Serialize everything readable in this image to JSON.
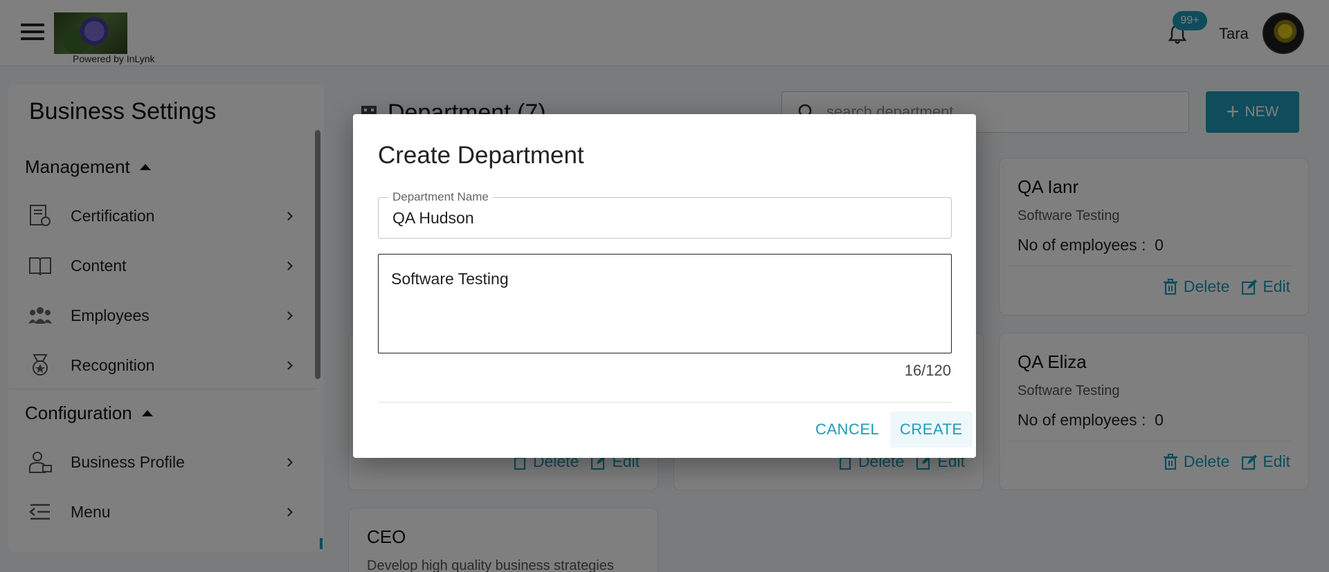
{
  "header": {
    "powered_by": "Powered by InLynk",
    "notification_badge": "99+",
    "user_name": "Tara"
  },
  "sidebar": {
    "title": "Business Settings",
    "sections": [
      {
        "label": "Management",
        "items": [
          {
            "label": "Certification",
            "icon": "certificate-icon"
          },
          {
            "label": "Content",
            "icon": "book-icon"
          },
          {
            "label": "Employees",
            "icon": "people-icon"
          },
          {
            "label": "Recognition",
            "icon": "medal-icon"
          }
        ]
      },
      {
        "label": "Configuration",
        "items": [
          {
            "label": "Business Profile",
            "icon": "business-person-icon"
          },
          {
            "label": "Menu",
            "icon": "menu-list-icon"
          }
        ]
      }
    ]
  },
  "main": {
    "title": "Department (7)",
    "search_placeholder": "search department...",
    "new_button": "NEW",
    "cards": [
      {
        "name": "QA Ianr",
        "description": "Software Testing",
        "employees_label": "No of employees :",
        "employees": "0",
        "delete": "Delete",
        "edit": "Edit"
      },
      {
        "name": "QA Eliza",
        "description": "Software Testing",
        "employees_label": "No of employees :",
        "employees": "0",
        "delete": "Delete",
        "edit": "Edit"
      },
      {
        "name": "",
        "description": "",
        "employees_label": "",
        "employees": "",
        "delete": "Delete",
        "edit": "Edit"
      },
      {
        "name": "",
        "description": "",
        "employees_label": "",
        "employees": "",
        "delete": "Delete",
        "edit": "Edit"
      },
      {
        "name": "CEO",
        "description": "Develop high quality business strategies",
        "employees_label": "",
        "employees": "",
        "delete": "",
        "edit": ""
      }
    ]
  },
  "modal": {
    "title": "Create Department",
    "name_label": "Department Name",
    "name_value": "QA Hudson",
    "description_value": "Software Testing",
    "counter": "16/120",
    "cancel": "CANCEL",
    "create": "CREATE"
  },
  "colors": {
    "accent": "#1e9bb8",
    "overlay": "rgba(0,0,0,0.5)"
  }
}
